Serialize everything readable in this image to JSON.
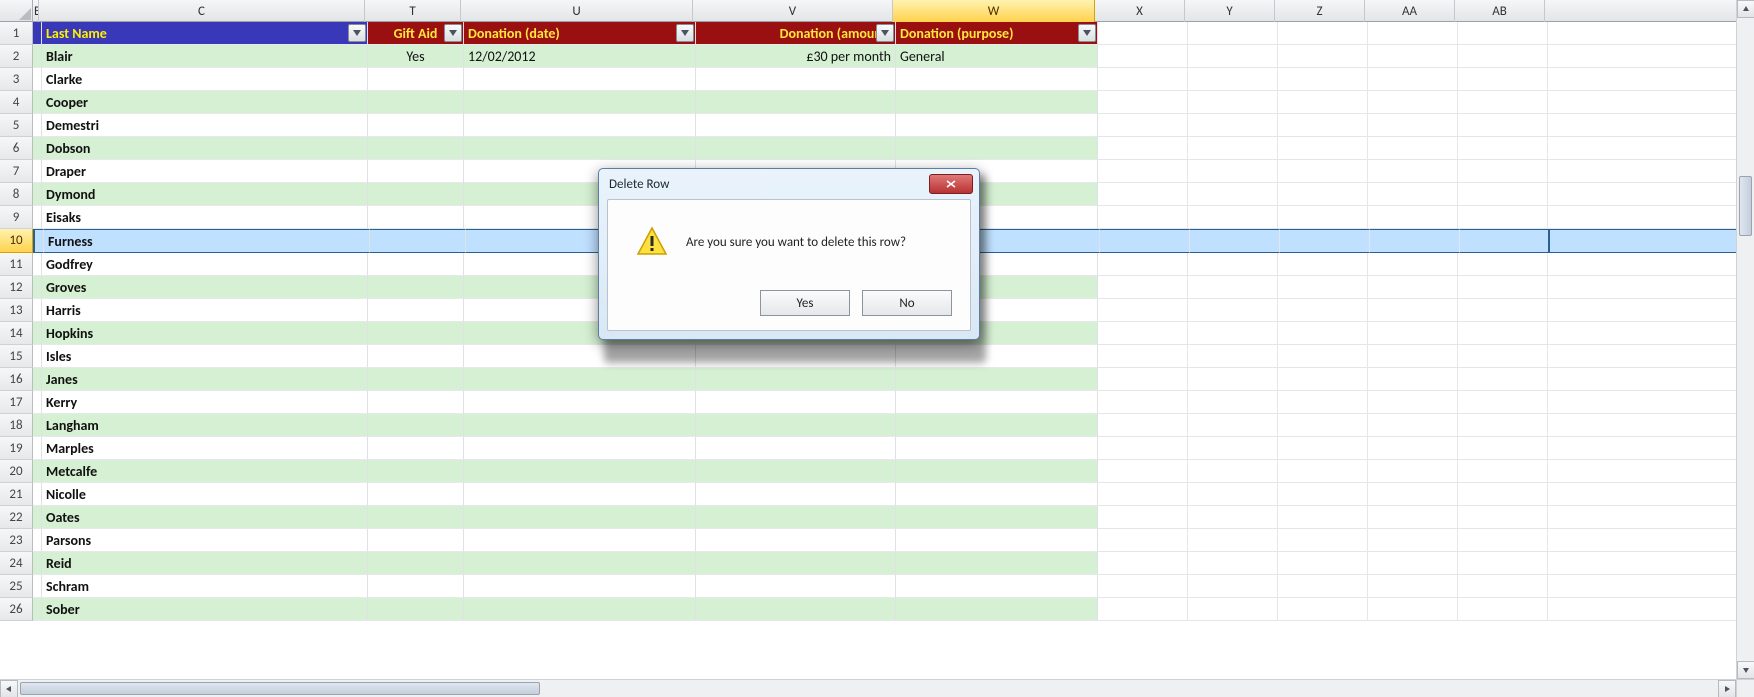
{
  "columns": {
    "letters": [
      "B",
      "C",
      "T",
      "U",
      "V",
      "W",
      "X",
      "Y",
      "Z",
      "AA",
      "AB"
    ],
    "widths": [
      6,
      326,
      96,
      232,
      200,
      202,
      90,
      90,
      90,
      90,
      90
    ],
    "selected_index": 5,
    "B_input": "B"
  },
  "headers": {
    "last_name": "Last Name",
    "gift_aid": "Gift Aid",
    "donation_date": "Donation (date)",
    "donation_amount": "Donation (amount)",
    "donation_purpose": "Donation (purpose)"
  },
  "rows": [
    {
      "n": 1,
      "type": "header"
    },
    {
      "n": 2,
      "last_name": "Blair",
      "gift_aid": "Yes",
      "donation_date": "12/02/2012",
      "donation_amount": "£30 per month",
      "donation_purpose": "General"
    },
    {
      "n": 3,
      "last_name": "Clarke"
    },
    {
      "n": 4,
      "last_name": "Cooper"
    },
    {
      "n": 5,
      "last_name": "Demestri"
    },
    {
      "n": 6,
      "last_name": "Dobson"
    },
    {
      "n": 7,
      "last_name": "Draper"
    },
    {
      "n": 8,
      "last_name": "Dymond"
    },
    {
      "n": 9,
      "last_name": "Eisaks"
    },
    {
      "n": 10,
      "last_name": "Furness",
      "selected": true
    },
    {
      "n": 11,
      "last_name": "Godfrey"
    },
    {
      "n": 12,
      "last_name": "Groves"
    },
    {
      "n": 13,
      "last_name": "Harris"
    },
    {
      "n": 14,
      "last_name": "Hopkins"
    },
    {
      "n": 15,
      "last_name": "Isles"
    },
    {
      "n": 16,
      "last_name": "Janes"
    },
    {
      "n": 17,
      "last_name": "Kerry"
    },
    {
      "n": 18,
      "last_name": "Langham"
    },
    {
      "n": 19,
      "last_name": "Marples"
    },
    {
      "n": 20,
      "last_name": "Metcalfe"
    },
    {
      "n": 21,
      "last_name": "Nicolle"
    },
    {
      "n": 22,
      "last_name": "Oates"
    },
    {
      "n": 23,
      "last_name": "Parsons"
    },
    {
      "n": 24,
      "last_name": "Reid"
    },
    {
      "n": 25,
      "last_name": "Schram"
    },
    {
      "n": 26,
      "last_name": "Sober"
    }
  ],
  "dialog": {
    "title": "Delete Row",
    "message": "Are you sure you want to delete this row?",
    "yes": "Yes",
    "no": "No"
  }
}
